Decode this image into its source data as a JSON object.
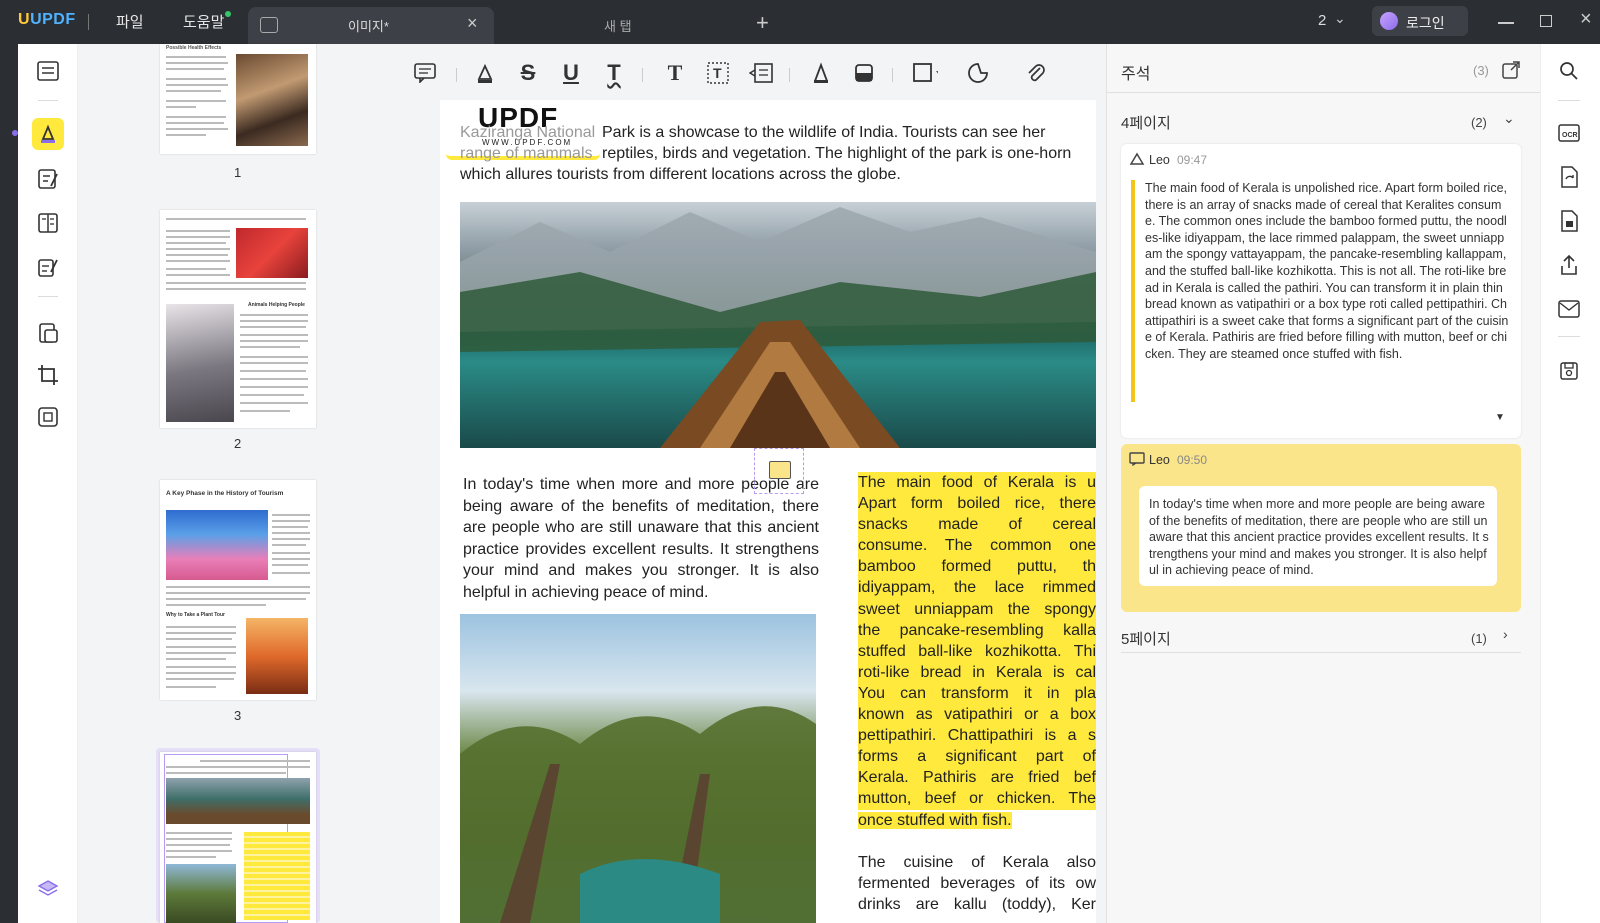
{
  "app": {
    "logo": "UPDF",
    "menu": {
      "file": "파일",
      "help": "도움말"
    },
    "tabs": [
      {
        "label": "이미지*"
      },
      {
        "label": "새 탭"
      }
    ],
    "window_count": "2",
    "login_label": "로그인"
  },
  "colors": {
    "accent_purple": "#8a6dea",
    "highlight_yellow": "#ffe93d",
    "note_yellow": "#fbe58b",
    "note_bar": "#f3c51a"
  },
  "toolbar": {
    "icons": [
      "comment-icon",
      "highlight-icon",
      "strikethrough-icon",
      "underline-icon",
      "squiggly-icon",
      "text-icon",
      "textbox-icon",
      "textcallout-icon",
      "pencil-icon",
      "eraser-icon",
      "shape-icon",
      "sticker-icon",
      "attachment-icon"
    ]
  },
  "thumbnails": {
    "pages": [
      {
        "number": "1"
      },
      {
        "number": "2"
      },
      {
        "number": "3"
      }
    ],
    "page1_title": "Possible Health Effects",
    "page2_heading": "Animals Helping People",
    "page3_title": "A Key Phase in the History of Tourism",
    "page3_subheading": "Why to Take a Plant Tour"
  },
  "document": {
    "watermark": {
      "logo": "UPDF",
      "url": "WWW.UPDF.COM"
    },
    "intro_overlap": "Kaziranga National",
    "intro_overlap2": "range of mammals",
    "intro": "Park is a showcase to the wildlife of India. Tourists can see her",
    "intro_line2": "reptiles, birds and vegetation. The highlight of the park is one-horn",
    "intro_line3": "which allures tourists from different locations across the globe.",
    "meditation": "In today's time when more and more people are being aware of the benefits of meditation, there are people who are still unaware that this ancient practice provides excellent results. It strengthens your mind and makes you stronger. It is also helpful in achieving peace of mind.",
    "highlight_lines": [
      "The main food of Kerala is u",
      "Apart form boiled rice, there",
      "snacks made of cereal",
      "consume. The common one",
      "bamboo formed puttu, th",
      "idiyappam, the lace rimmed",
      "sweet unniappam the spongy",
      "the pancake-resembling kalla",
      "stuffed ball-like kozhikotta. Thi",
      "roti-like bread in Kerala is cal",
      "You can transform it in pla",
      "known as vatipathiri or a box",
      "pettipathiri. Chattipathiri is a s",
      "forms a significant part of",
      "Kerala. Pathiris are fried bef",
      "mutton, beef or chicken. The",
      "once stuffed with fish."
    ],
    "cuisine_lines": [
      "The cuisine of Kerala also",
      "fermented beverages of its ow",
      "drinks are kallu (toddy), Ker"
    ]
  },
  "comments": {
    "title": "주석",
    "total": "(3)",
    "groups": [
      {
        "page_label": "4페이지",
        "count": "(2)",
        "items": [
          {
            "author": "Leo",
            "time": "09:47",
            "text": "The main food of Kerala is unpolished rice. Apart form boiled rice, there is an array of snacks made of cereal that Keralites consume. The common ones include the bamboo formed puttu, the noodles-like idiyappam, the lace rimmed palappam, the sweet unniappam the spongy vattayappam, the pancake-resembling kallappam, and the stuffed ball-like kozhikotta. This is not all. The roti-like bread in Kerala is called the pathiri. You can transform it in plain thin bread known as vatipathiri or a box type roti called pettipathiri. Chattipathiri is a sweet cake that forms a significant part of the cuisine of Kerala. Pathiris are fried before filling with mutton, beef or chicken. They are steamed once stuffed with fish."
          },
          {
            "author": "Leo",
            "time": "09:50",
            "text": "In today's time when more and more people are being aware of the benefits of meditation, there are people who are still unaware that this ancient practice provides excellent results. It strengthens your mind and makes you stronger. It is also helpful in achieving peace of mind."
          }
        ]
      },
      {
        "page_label": "5페이지",
        "count": "(1)"
      }
    ]
  }
}
